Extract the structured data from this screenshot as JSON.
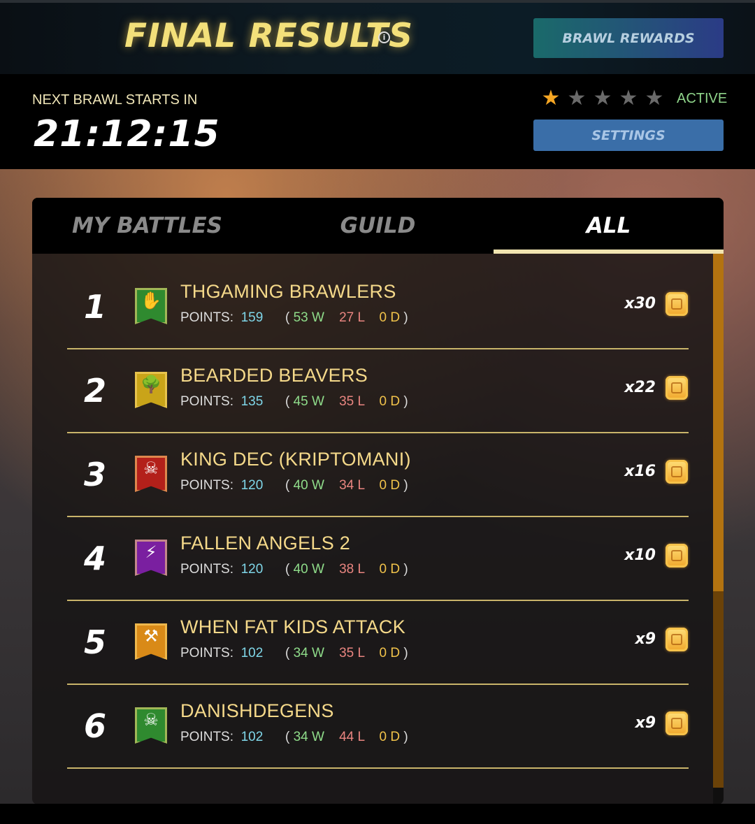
{
  "header": {
    "title": "FINAL RESULTS",
    "info_icon": "i",
    "rewards_button": "BRAWL REWARDS"
  },
  "status": {
    "next_label": "NEXT BRAWL STARTS IN",
    "timer": "21:12:15",
    "stars_filled": 1,
    "stars_total": 5,
    "active_label": "ACTIVE",
    "settings_button": "SETTINGS"
  },
  "tabs": [
    {
      "label": "MY BATTLES",
      "active": false
    },
    {
      "label": "GUILD",
      "active": false
    },
    {
      "label": "ALL",
      "active": true
    }
  ],
  "rows": [
    {
      "rank": "1",
      "name": "THGAMING BRAWLERS",
      "points_label": "POINTS:",
      "points": "159",
      "wins": "53 W",
      "losses": "27 L",
      "draws": "0 D",
      "multiplier": "x30",
      "banner_color": "#2f8a2f",
      "emblem": "hand-icon",
      "emblem_glyph": "✋"
    },
    {
      "rank": "2",
      "name": "BEARDED BEAVERS",
      "points_label": "POINTS:",
      "points": "135",
      "wins": "45 W",
      "losses": "35 L",
      "draws": "0 D",
      "multiplier": "x22",
      "banner_color": "#c9a419",
      "emblem": "tree-icon",
      "emblem_glyph": "🌳"
    },
    {
      "rank": "3",
      "name": "KING DEC (KRIPTOMANI)",
      "points_label": "POINTS:",
      "points": "120",
      "wins": "40 W",
      "losses": "34 L",
      "draws": "0 D",
      "multiplier": "x16",
      "banner_color": "#b3201a",
      "emblem": "skull-icon",
      "emblem_glyph": "☠"
    },
    {
      "rank": "4",
      "name": "FALLEN ANGELS 2",
      "points_label": "POINTS:",
      "points": "120",
      "wins": "40 W",
      "losses": "38 L",
      "draws": "0 D",
      "multiplier": "x10",
      "banner_color": "#7a1fa0",
      "emblem": "lightning-icon",
      "emblem_glyph": "⚡"
    },
    {
      "rank": "5",
      "name": "WHEN FAT KIDS ATTACK",
      "points_label": "POINTS:",
      "points": "102",
      "wins": "34 W",
      "losses": "35 L",
      "draws": "0 D",
      "multiplier": "x9",
      "banner_color": "#d98a18",
      "emblem": "axe-icon",
      "emblem_glyph": "⚒"
    },
    {
      "rank": "6",
      "name": "DANISHDEGENS",
      "points_label": "POINTS:",
      "points": "102",
      "wins": "34 W",
      "losses": "44 L",
      "draws": "0 D",
      "multiplier": "x9",
      "banner_color": "#2f8a2f",
      "emblem": "skull-icon",
      "emblem_glyph": "☠"
    }
  ],
  "colors": {
    "title": "#f3e07a",
    "accent_underline": "#f1e4b0",
    "points": "#7fd6e8",
    "wins": "#8fdc8a",
    "losses": "#e98580",
    "draws": "#f0c24a",
    "star_filled": "#f5a623",
    "star_empty": "#6a6a6a"
  }
}
